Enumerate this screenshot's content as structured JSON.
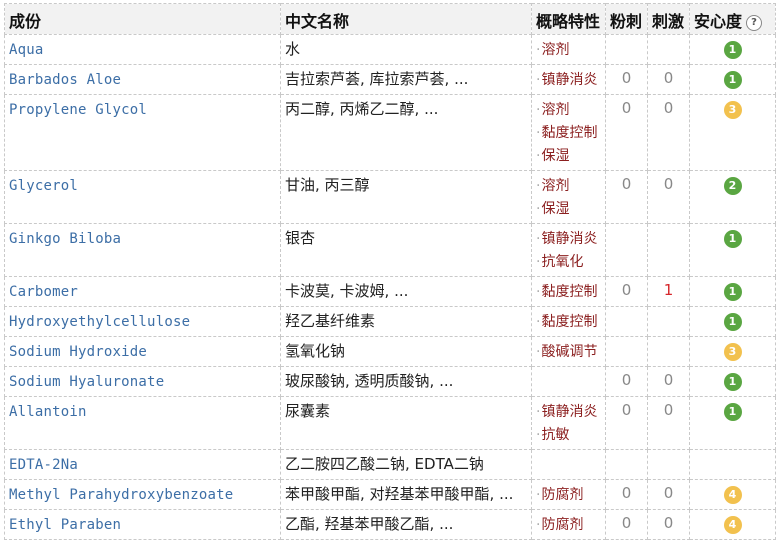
{
  "headers": {
    "ingredient": "成份",
    "chinese_name": "中文名称",
    "features": "概略特性",
    "acne": "粉刺",
    "irritation": "刺激",
    "safety": "安心度",
    "help": "?"
  },
  "colors": {
    "green": "#5aa642",
    "yellow": "#f2c14e",
    "link": "#3c6ea6",
    "feature": "#8b1f1f",
    "red_number": "#d6262b"
  },
  "rows": [
    {
      "ingredient": "Aqua",
      "chinese_name": "水",
      "features": [
        "溶剂"
      ],
      "acne": "",
      "irritation": "",
      "safety": "1",
      "safety_color": "green"
    },
    {
      "ingredient": "Barbados Aloe",
      "chinese_name": "吉拉索芦荟, 库拉索芦荟, ...",
      "features": [
        "镇静消炎"
      ],
      "acne": "0",
      "irritation": "0",
      "safety": "1",
      "safety_color": "green"
    },
    {
      "ingredient": "Propylene Glycol",
      "chinese_name": "丙二醇, 丙烯乙二醇, ...",
      "features": [
        "溶剂",
        "黏度控制",
        "保湿"
      ],
      "acne": "0",
      "irritation": "0",
      "safety": "3",
      "safety_color": "yellow"
    },
    {
      "ingredient": "Glycerol",
      "chinese_name": "甘油, 丙三醇",
      "features": [
        "溶剂",
        "保湿"
      ],
      "acne": "0",
      "irritation": "0",
      "safety": "2",
      "safety_color": "green"
    },
    {
      "ingredient": "Ginkgo Biloba",
      "chinese_name": "银杏",
      "features": [
        "镇静消炎",
        "抗氧化"
      ],
      "acne": "",
      "irritation": "",
      "safety": "1",
      "safety_color": "green"
    },
    {
      "ingredient": "Carbomer",
      "chinese_name": "卡波莫, 卡波姆, ...",
      "features": [
        "黏度控制"
      ],
      "acne": "0",
      "irritation": "1",
      "safety": "1",
      "safety_color": "green"
    },
    {
      "ingredient": "Hydroxyethylcellulose",
      "chinese_name": "羟乙基纤维素",
      "features": [
        "黏度控制"
      ],
      "acne": "",
      "irritation": "",
      "safety": "1",
      "safety_color": "green"
    },
    {
      "ingredient": "Sodium Hydroxide",
      "chinese_name": "氢氧化钠",
      "features": [
        "酸碱调节"
      ],
      "acne": "",
      "irritation": "",
      "safety": "3",
      "safety_color": "yellow"
    },
    {
      "ingredient": "Sodium Hyaluronate",
      "chinese_name": "玻尿酸钠, 透明质酸钠, ...",
      "features": [],
      "acne": "0",
      "irritation": "0",
      "safety": "1",
      "safety_color": "green"
    },
    {
      "ingredient": "Allantoin",
      "chinese_name": "尿囊素",
      "features": [
        "镇静消炎",
        "抗敏"
      ],
      "acne": "0",
      "irritation": "0",
      "safety": "1",
      "safety_color": "green"
    },
    {
      "ingredient": "EDTA-2Na",
      "chinese_name": "乙二胺四乙酸二钠, EDTA二钠",
      "features": [],
      "acne": "",
      "irritation": "",
      "safety": "",
      "safety_color": ""
    },
    {
      "ingredient": "Methyl Parahydroxybenzoate",
      "chinese_name": "苯甲酸甲酯, 对羟基苯甲酸甲酯, ...",
      "features": [
        "防腐剂"
      ],
      "acne": "0",
      "irritation": "0",
      "safety": "4",
      "safety_color": "yellow"
    },
    {
      "ingredient": "Ethyl Paraben",
      "chinese_name": "乙酯, 羟基苯甲酸乙酯, ...",
      "features": [
        "防腐剂"
      ],
      "acne": "0",
      "irritation": "0",
      "safety": "4",
      "safety_color": "yellow"
    }
  ]
}
